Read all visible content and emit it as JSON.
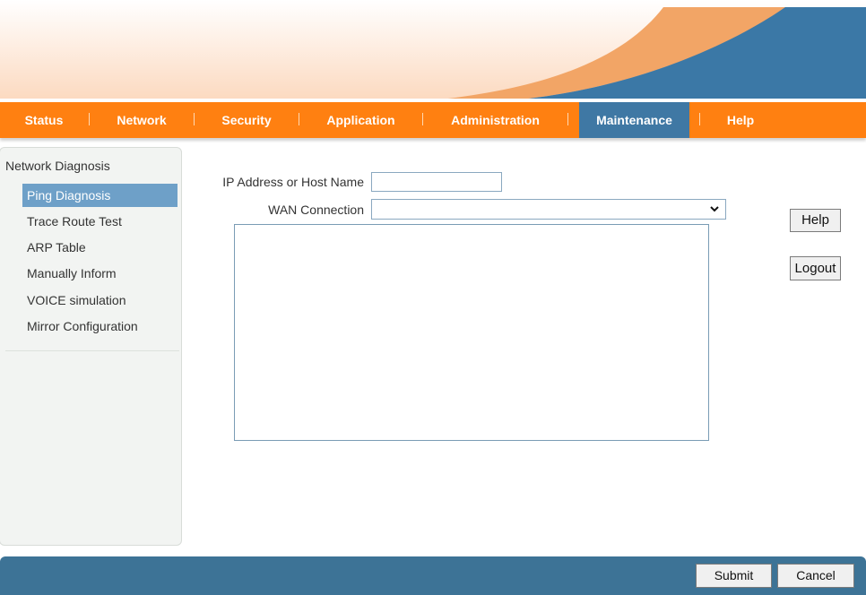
{
  "nav": {
    "items": [
      {
        "label": "Status"
      },
      {
        "label": "Network"
      },
      {
        "label": "Security"
      },
      {
        "label": "Application"
      },
      {
        "label": "Administration"
      },
      {
        "label": "Maintenance"
      },
      {
        "label": "Help"
      }
    ],
    "active": "Maintenance"
  },
  "sidebar": {
    "title": "Network Diagnosis",
    "items": [
      {
        "label": "Ping Diagnosis"
      },
      {
        "label": "Trace Route Test"
      },
      {
        "label": "ARP Table"
      },
      {
        "label": "Manually Inform"
      },
      {
        "label": "VOICE simulation"
      },
      {
        "label": "Mirror Configuration"
      }
    ],
    "active": "Ping Diagnosis"
  },
  "form": {
    "ip_label": "IP Address or Host Name",
    "ip_value": "",
    "wan_label": "WAN Connection",
    "wan_value": "",
    "result_text": ""
  },
  "side_buttons": {
    "help": "Help",
    "logout": "Logout"
  },
  "footer": {
    "submit": "Submit",
    "cancel": "Cancel"
  },
  "colors": {
    "nav_orange": "#ff8011",
    "nav_active_blue": "#3f78a4",
    "sidebar_active": "#6ea0c8",
    "footer_blue": "#3d7396",
    "banner_orange": "#f2a566",
    "banner_blue": "#3b78a6"
  }
}
